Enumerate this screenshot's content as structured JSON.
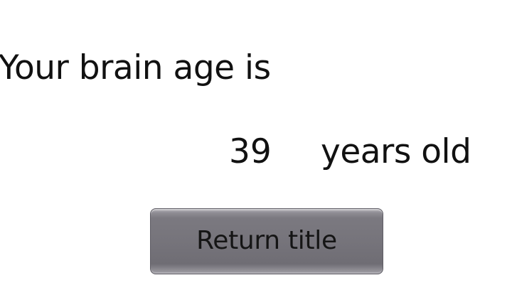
{
  "result": {
    "heading": "Your brain age is",
    "age_value": "39",
    "age_unit": "years old"
  },
  "actions": {
    "return_label": "Return title"
  },
  "colors": {
    "background": "#ffffff",
    "text": "#111111",
    "button": "#76747b"
  }
}
